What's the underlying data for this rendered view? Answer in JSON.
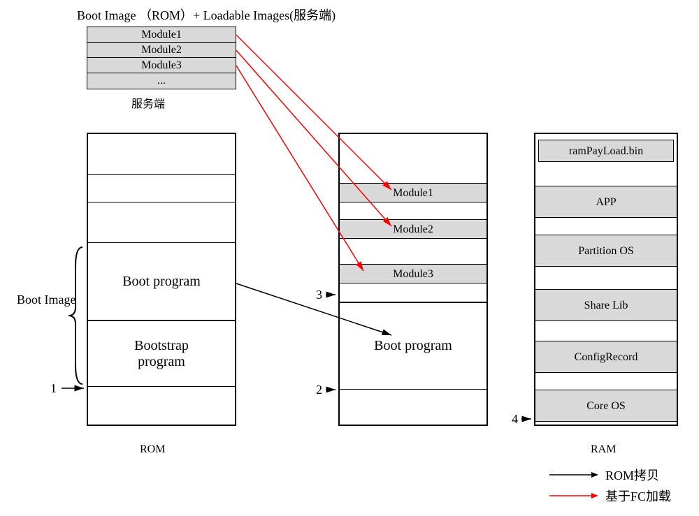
{
  "title": "Boot Image （ROM）+ Loadable Images(服务端)",
  "server": {
    "rows": [
      "Module1",
      "Module2",
      "Module3",
      "..."
    ],
    "label": "服务端"
  },
  "rom": {
    "boot_program": "Boot program",
    "bootstrap": "Bootstrap program",
    "label": "ROM",
    "boot_image_label": "Boot Image"
  },
  "middle": {
    "mod1": "Module1",
    "mod2": "Module2",
    "mod3": "Module3",
    "boot": "Boot program"
  },
  "ram": {
    "payload": "ramPayLoad.bin",
    "app": "APP",
    "partition": "Partition OS",
    "share": "Share Lib",
    "config": "ConfigRecord",
    "core": "Core OS",
    "label": "RAM"
  },
  "nums": {
    "n1": "1",
    "n2": "2",
    "n3": "3",
    "n4": "4"
  },
  "legend": {
    "rom_copy": "ROM拷贝",
    "fc_load": "基于FC加载"
  },
  "colors": {
    "red": "#ff0000",
    "black": "#000000",
    "gray": "#d9d9d9"
  }
}
